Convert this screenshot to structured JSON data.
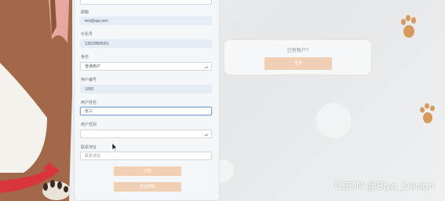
{
  "register": {
    "email_label": "邮箱",
    "email_value": "test@qq.com",
    "phone_label": "手机号",
    "phone_value": "13623800001",
    "role_label": "身份",
    "role_value": "普通用户",
    "user_no_label": "用户编号",
    "user_no_value": "1000",
    "user_name_label": "用户姓名",
    "user_name_value": "张三",
    "gender_label": "用户性别",
    "gender_value": "",
    "address_label": "联系地址",
    "address_placeholder": "联系地址",
    "submit_label": "注册",
    "forgot_label": "忘记密码"
  },
  "login": {
    "prompt": "已有账户?",
    "button_label": "登录"
  },
  "watermark": "CSDN @Biye_Design",
  "colors": {
    "button": "#f0cfb4",
    "panel": "#f4f7fa",
    "paw": "#d79a5c",
    "dog_fur": "#a2684a",
    "collar": "#d8363a"
  }
}
